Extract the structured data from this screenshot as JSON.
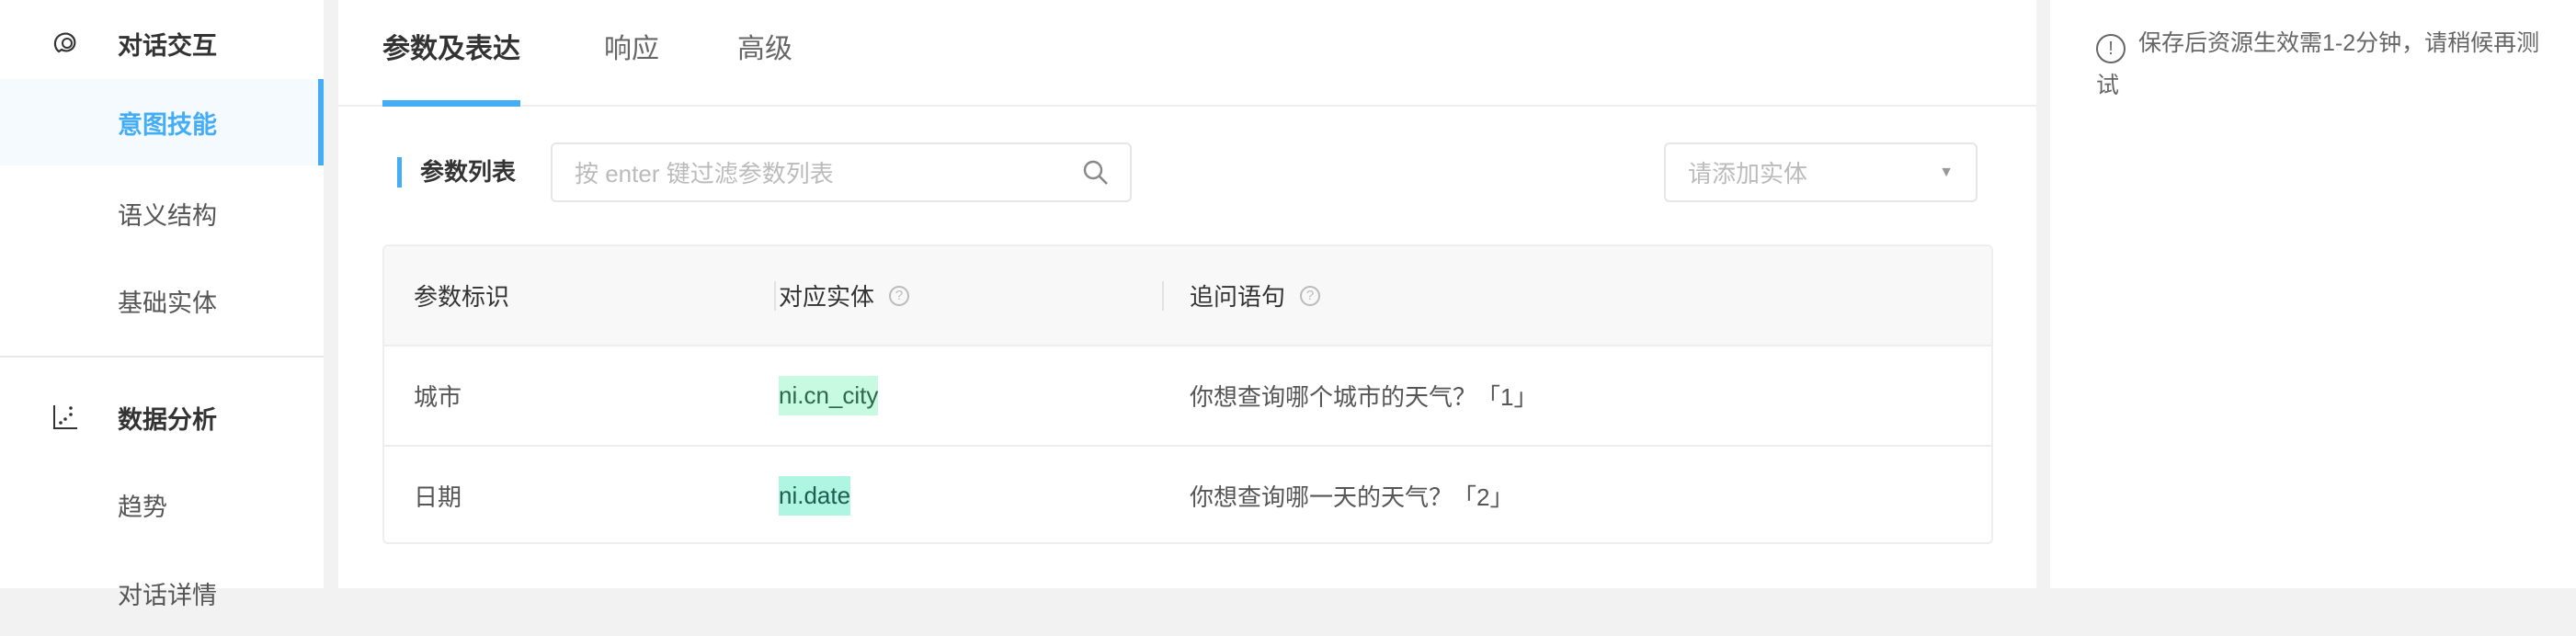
{
  "sidebar": {
    "groups": [
      {
        "label": "对话交互",
        "icon": "chat-icon",
        "items": [
          "意图技能",
          "语义结构",
          "基础实体"
        ]
      },
      {
        "label": "数据分析",
        "icon": "scatter-chart-icon",
        "items": [
          "趋势",
          "对话详情"
        ]
      }
    ],
    "active": "意图技能"
  },
  "tabs": [
    "参数及表达",
    "响应",
    "高级"
  ],
  "params": {
    "label": "参数列表",
    "search_placeholder": "按 enter 键过滤参数列表",
    "entity_placeholder": "请添加实体"
  },
  "table": {
    "headers": [
      "参数标识",
      "对应实体",
      "追问语句"
    ],
    "rows": [
      {
        "name": "城市",
        "entity": "ni.cn_city",
        "prompt": "你想查询哪个城市的天气？「1」"
      },
      {
        "name": "日期",
        "entity": "ni.date",
        "prompt": "你想查询哪一天的天气？「2」"
      }
    ]
  },
  "notice": "保存后资源生效需1-2分钟，请稍候再测试",
  "colors": {
    "accent": "#44adf5"
  }
}
